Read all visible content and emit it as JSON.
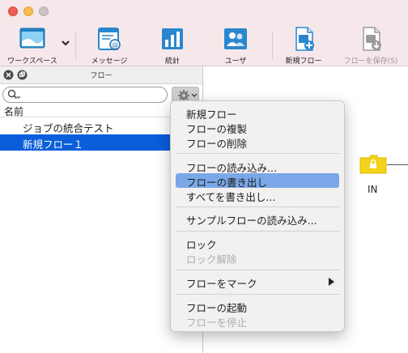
{
  "window": {
    "traffic_lights": [
      "close",
      "minimize",
      "zoom"
    ]
  },
  "toolbar": {
    "items": [
      {
        "label": "ワークスペース",
        "icon": "workspace-icon",
        "enabled": true
      },
      {
        "label": "メッセージ",
        "icon": "message-icon",
        "enabled": true
      },
      {
        "label": "統計",
        "icon": "statistics-icon",
        "enabled": true
      },
      {
        "label": "ユーザ",
        "icon": "users-icon",
        "enabled": true
      },
      {
        "label": "新規フロー",
        "icon": "new-flow-icon",
        "enabled": true
      },
      {
        "label": "フローを保存(S)",
        "icon": "save-flow-icon",
        "enabled": false
      }
    ]
  },
  "panel": {
    "title": "フロー",
    "search": {
      "value": "",
      "placeholder": ""
    },
    "column_header": "名前",
    "rows": [
      {
        "label": "ジョブの統合テスト",
        "selected": false
      },
      {
        "label": "新規フロー１",
        "selected": true
      }
    ]
  },
  "canvas": {
    "node_label": "IN"
  },
  "context_menu": {
    "groups": [
      [
        {
          "label": "新規フロー",
          "enabled": true
        },
        {
          "label": "フローの複製",
          "enabled": true
        },
        {
          "label": "フローの削除",
          "enabled": true
        }
      ],
      [
        {
          "label": "フローの読み込み...",
          "enabled": true
        },
        {
          "label": "フローの書き出し",
          "enabled": true,
          "highlighted": true
        },
        {
          "label": "すべてを書き出し...",
          "enabled": true
        }
      ],
      [
        {
          "label": "サンプルフローの読み込み...",
          "enabled": true
        }
      ],
      [
        {
          "label": "ロック",
          "enabled": true
        },
        {
          "label": "ロック解除",
          "enabled": false
        }
      ],
      [
        {
          "label": "フローをマーク",
          "enabled": true,
          "submenu": true
        }
      ],
      [
        {
          "label": "フローの起動",
          "enabled": true
        },
        {
          "label": "フローを停止",
          "enabled": false
        }
      ]
    ]
  },
  "colors": {
    "selection": "#0a5edb",
    "menu_highlight": "#7aa7e7",
    "folder": "#f4d21a",
    "titlebar": "#f6e8ea"
  }
}
